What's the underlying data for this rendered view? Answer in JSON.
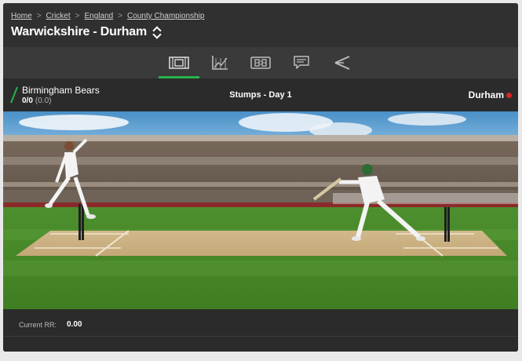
{
  "breadcrumb": {
    "items": [
      "Home",
      "Cricket",
      "England",
      "County Championship"
    ]
  },
  "match": {
    "title": "Warwickshire - Durham",
    "status": "Stumps - Day 1",
    "home_team": "Birmingham Bears",
    "home_score": "0/0",
    "home_overs": "(0.0)",
    "away_team": "Durham"
  },
  "tabs": [
    {
      "id": "pitch-view",
      "icon": "pitch-icon",
      "active": true
    },
    {
      "id": "stats",
      "icon": "line-chart-icon",
      "active": false
    },
    {
      "id": "scoreboard",
      "icon": "scoreboard-icon",
      "active": false
    },
    {
      "id": "commentary",
      "icon": "speech-bubble-icon",
      "active": false
    },
    {
      "id": "wagon-wheel",
      "icon": "wagon-wheel-icon",
      "active": false
    }
  ],
  "footer": {
    "rr_label": "Current RR:",
    "rr_value": "0.00"
  },
  "colors": {
    "accent": "#26b34a",
    "panel": "#2b2b2b",
    "header": "#303030",
    "tabbar": "#3a3a3a",
    "ball": "#d3262b"
  }
}
